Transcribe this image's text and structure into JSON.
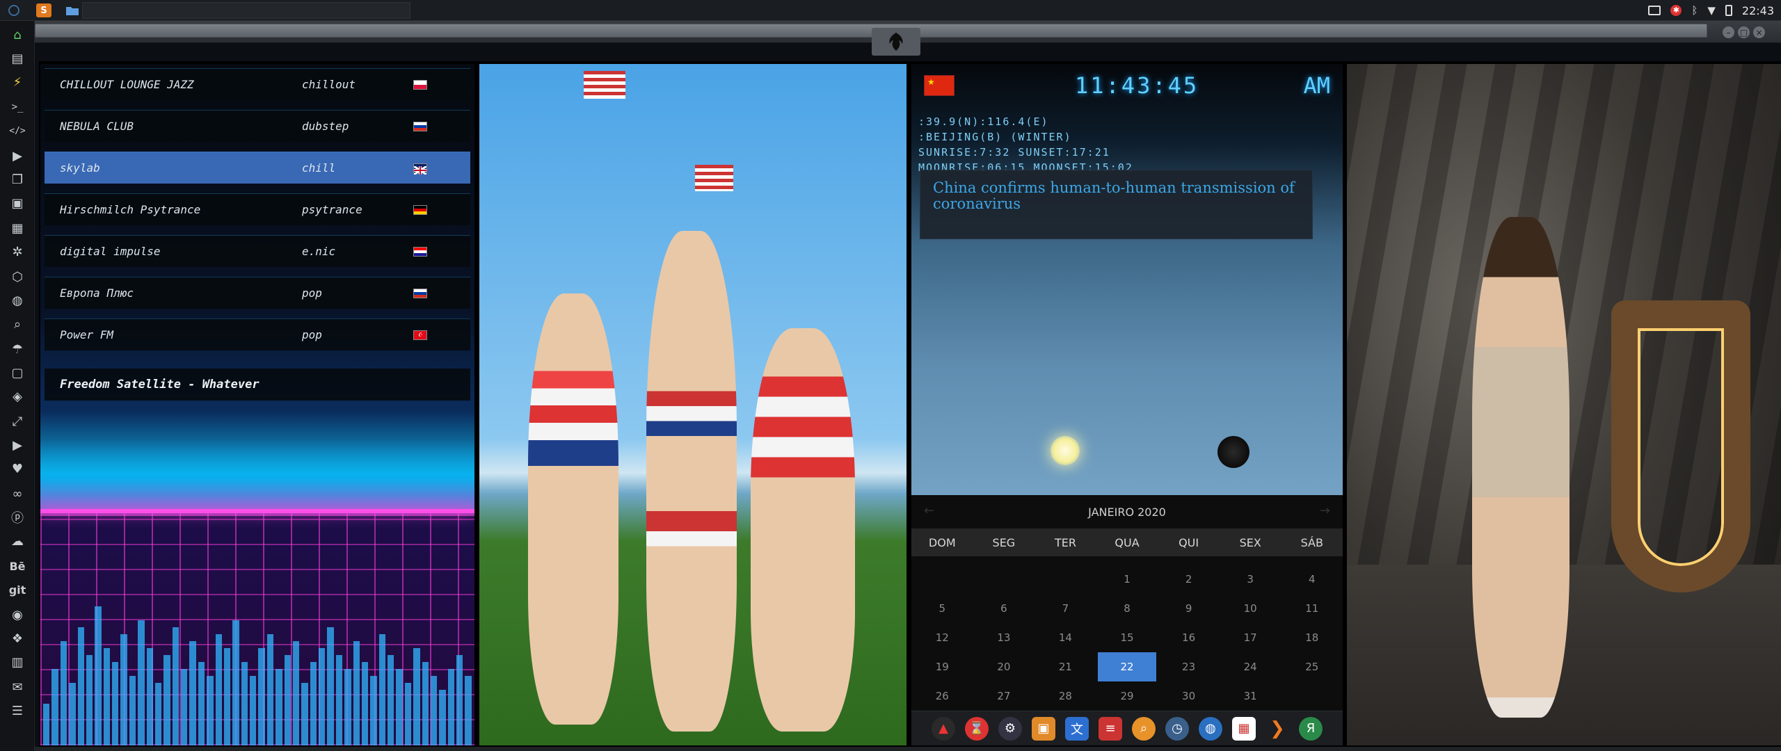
{
  "panel": {
    "clock": "22:43",
    "tray_icons": [
      "screenshot-icon",
      "alert-icon",
      "bluetooth-icon",
      "network-icon",
      "battery-icon"
    ]
  },
  "window_controls": [
    "minimize-icon",
    "maximize-icon",
    "close-icon"
  ],
  "dock_left_text": {
    "behance": "Bē",
    "git": "git"
  },
  "radio": {
    "stations": [
      {
        "name": "CHILLOUT LOUNGE JAZZ",
        "genre": "chillout",
        "flag": "Poland"
      },
      {
        "name": "NEBULA CLUB",
        "genre": "dubstep",
        "flag": "Russia"
      },
      {
        "name": "skylab",
        "genre": "chill",
        "flag": "United Kingdom",
        "active": true
      },
      {
        "name": "Hirschmilch Psytrance",
        "genre": "psytrance",
        "flag": "Germany"
      },
      {
        "name": "digital impulse",
        "genre": "e.nic",
        "flag": "Croatia"
      },
      {
        "name": "Европа Плюс",
        "genre": "pop",
        "flag": "Russia"
      },
      {
        "name": "Power FM",
        "genre": "pop",
        "flag": "Turkey"
      }
    ],
    "now_playing": "Freedom Satellite - Whatever"
  },
  "info": {
    "time": "11:43:45",
    "ampm": "AM",
    "coords": ":39.9(N):116.4(E)",
    "location": ":BEIJING(B) (WINTER)",
    "sun": "SUNRISE:7:32 SUNSET:17:21",
    "moon": "MOONRISE:06:15 MOONSET:15:02",
    "news": "China confirms human-to-human transmission of coronavirus"
  },
  "calendar": {
    "month": "JANEIRO 2020",
    "days_of_week": [
      "DOM",
      "SEG",
      "TER",
      "QUA",
      "QUI",
      "SEX",
      "SÁB"
    ],
    "weeks": [
      [
        "",
        "",
        "",
        "1",
        "2",
        "3",
        "4"
      ],
      [
        "5",
        "6",
        "7",
        "8",
        "9",
        "10",
        "11"
      ],
      [
        "12",
        "13",
        "14",
        "15",
        "16",
        "17",
        "18"
      ],
      [
        "19",
        "20",
        "21",
        "22",
        "23",
        "24",
        "25"
      ],
      [
        "26",
        "27",
        "28",
        "29",
        "30",
        "31",
        ""
      ]
    ],
    "today": "22"
  },
  "colors": {
    "accent_blue": "#3f7fd4",
    "neon_cyan": "#5fd0ff",
    "neon_pink": "#ff4fe8",
    "news_blue": "#3ca7e8"
  }
}
